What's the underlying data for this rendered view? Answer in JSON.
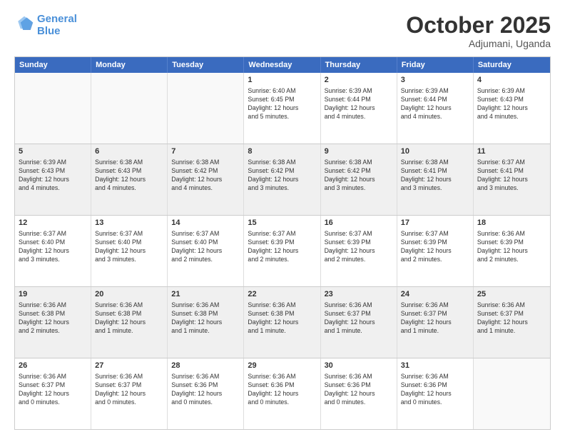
{
  "header": {
    "logo_line1": "General",
    "logo_line2": "Blue",
    "month": "October 2025",
    "location": "Adjumani, Uganda"
  },
  "days": [
    "Sunday",
    "Monday",
    "Tuesday",
    "Wednesday",
    "Thursday",
    "Friday",
    "Saturday"
  ],
  "rows": [
    [
      {
        "day": "",
        "content": ""
      },
      {
        "day": "",
        "content": ""
      },
      {
        "day": "",
        "content": ""
      },
      {
        "day": "1",
        "content": "Sunrise: 6:40 AM\nSunset: 6:45 PM\nDaylight: 12 hours\nand 5 minutes."
      },
      {
        "day": "2",
        "content": "Sunrise: 6:39 AM\nSunset: 6:44 PM\nDaylight: 12 hours\nand 4 minutes."
      },
      {
        "day": "3",
        "content": "Sunrise: 6:39 AM\nSunset: 6:44 PM\nDaylight: 12 hours\nand 4 minutes."
      },
      {
        "day": "4",
        "content": "Sunrise: 6:39 AM\nSunset: 6:43 PM\nDaylight: 12 hours\nand 4 minutes."
      }
    ],
    [
      {
        "day": "5",
        "content": "Sunrise: 6:39 AM\nSunset: 6:43 PM\nDaylight: 12 hours\nand 4 minutes."
      },
      {
        "day": "6",
        "content": "Sunrise: 6:38 AM\nSunset: 6:43 PM\nDaylight: 12 hours\nand 4 minutes."
      },
      {
        "day": "7",
        "content": "Sunrise: 6:38 AM\nSunset: 6:42 PM\nDaylight: 12 hours\nand 4 minutes."
      },
      {
        "day": "8",
        "content": "Sunrise: 6:38 AM\nSunset: 6:42 PM\nDaylight: 12 hours\nand 3 minutes."
      },
      {
        "day": "9",
        "content": "Sunrise: 6:38 AM\nSunset: 6:42 PM\nDaylight: 12 hours\nand 3 minutes."
      },
      {
        "day": "10",
        "content": "Sunrise: 6:38 AM\nSunset: 6:41 PM\nDaylight: 12 hours\nand 3 minutes."
      },
      {
        "day": "11",
        "content": "Sunrise: 6:37 AM\nSunset: 6:41 PM\nDaylight: 12 hours\nand 3 minutes."
      }
    ],
    [
      {
        "day": "12",
        "content": "Sunrise: 6:37 AM\nSunset: 6:40 PM\nDaylight: 12 hours\nand 3 minutes."
      },
      {
        "day": "13",
        "content": "Sunrise: 6:37 AM\nSunset: 6:40 PM\nDaylight: 12 hours\nand 3 minutes."
      },
      {
        "day": "14",
        "content": "Sunrise: 6:37 AM\nSunset: 6:40 PM\nDaylight: 12 hours\nand 2 minutes."
      },
      {
        "day": "15",
        "content": "Sunrise: 6:37 AM\nSunset: 6:39 PM\nDaylight: 12 hours\nand 2 minutes."
      },
      {
        "day": "16",
        "content": "Sunrise: 6:37 AM\nSunset: 6:39 PM\nDaylight: 12 hours\nand 2 minutes."
      },
      {
        "day": "17",
        "content": "Sunrise: 6:37 AM\nSunset: 6:39 PM\nDaylight: 12 hours\nand 2 minutes."
      },
      {
        "day": "18",
        "content": "Sunrise: 6:36 AM\nSunset: 6:39 PM\nDaylight: 12 hours\nand 2 minutes."
      }
    ],
    [
      {
        "day": "19",
        "content": "Sunrise: 6:36 AM\nSunset: 6:38 PM\nDaylight: 12 hours\nand 2 minutes."
      },
      {
        "day": "20",
        "content": "Sunrise: 6:36 AM\nSunset: 6:38 PM\nDaylight: 12 hours\nand 1 minute."
      },
      {
        "day": "21",
        "content": "Sunrise: 6:36 AM\nSunset: 6:38 PM\nDaylight: 12 hours\nand 1 minute."
      },
      {
        "day": "22",
        "content": "Sunrise: 6:36 AM\nSunset: 6:38 PM\nDaylight: 12 hours\nand 1 minute."
      },
      {
        "day": "23",
        "content": "Sunrise: 6:36 AM\nSunset: 6:37 PM\nDaylight: 12 hours\nand 1 minute."
      },
      {
        "day": "24",
        "content": "Sunrise: 6:36 AM\nSunset: 6:37 PM\nDaylight: 12 hours\nand 1 minute."
      },
      {
        "day": "25",
        "content": "Sunrise: 6:36 AM\nSunset: 6:37 PM\nDaylight: 12 hours\nand 1 minute."
      }
    ],
    [
      {
        "day": "26",
        "content": "Sunrise: 6:36 AM\nSunset: 6:37 PM\nDaylight: 12 hours\nand 0 minutes."
      },
      {
        "day": "27",
        "content": "Sunrise: 6:36 AM\nSunset: 6:37 PM\nDaylight: 12 hours\nand 0 minutes."
      },
      {
        "day": "28",
        "content": "Sunrise: 6:36 AM\nSunset: 6:36 PM\nDaylight: 12 hours\nand 0 minutes."
      },
      {
        "day": "29",
        "content": "Sunrise: 6:36 AM\nSunset: 6:36 PM\nDaylight: 12 hours\nand 0 minutes."
      },
      {
        "day": "30",
        "content": "Sunrise: 6:36 AM\nSunset: 6:36 PM\nDaylight: 12 hours\nand 0 minutes."
      },
      {
        "day": "31",
        "content": "Sunrise: 6:36 AM\nSunset: 6:36 PM\nDaylight: 12 hours\nand 0 minutes."
      },
      {
        "day": "",
        "content": ""
      }
    ]
  ]
}
